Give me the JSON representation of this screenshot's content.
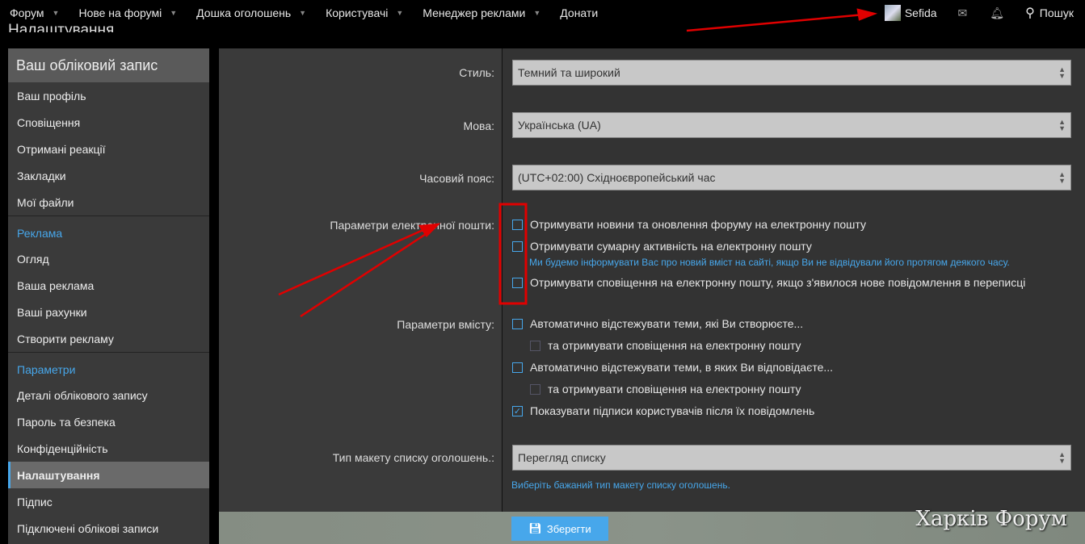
{
  "nav": {
    "items": [
      {
        "label": "Форум",
        "caret": true
      },
      {
        "label": "Нове на форумі",
        "caret": true
      },
      {
        "label": "Дошка оголошень",
        "caret": true
      },
      {
        "label": "Користувачі",
        "caret": true
      },
      {
        "label": "Менеджер реклами",
        "caret": true
      },
      {
        "label": "Донати",
        "caret": false
      }
    ],
    "username": "Sefida",
    "search": "Пошук"
  },
  "page_title": "Налаштування",
  "sidebar": {
    "header": "Ваш обліковий запис",
    "group1": [
      "Ваш профіль",
      "Сповіщення",
      "Отримані реакції",
      "Закладки",
      "Мої файли"
    ],
    "sec2": "Реклама",
    "group2": [
      "Огляд",
      "Ваша реклама",
      "Ваші рахунки",
      "Створити рекламу"
    ],
    "sec3": "Параметри",
    "group3": [
      "Деталі облікового запису",
      "Пароль та безпека",
      "Конфіденційність",
      "Налаштування",
      "Підпис",
      "Підключені облікові записи"
    ]
  },
  "form": {
    "style_label": "Стиль:",
    "style_value": "Темний та широкий",
    "lang_label": "Мова:",
    "lang_value": "Українська (UA)",
    "tz_label": "Часовий пояс:",
    "tz_value": "(UTC+02:00) Східноєвропейський час",
    "email_label": "Параметри електронної пошти:",
    "email_opts": [
      "Отримувати новини та оновлення форуму на електронну пошту",
      "Отримувати сумарну активність на електронну пошту",
      "Отримувати сповіщення на електронну пошту, якщо з'явилося нове повідомлення в переписці"
    ],
    "email_hint": "Ми будемо інформувати Вас про новий вміст на сайті, якщо Ви не відвідували його протягом деякого часу.",
    "content_label": "Параметри вмісту:",
    "content_opts": [
      "Автоматично відстежувати теми, які Ви створюєте...",
      "та отримувати сповіщення на електронну пошту",
      "Автоматично відстежувати теми, в яких Ви відповідаєте...",
      "та отримувати сповіщення на електронну пошту",
      "Показувати підписи користувачів після їх повідомлень"
    ],
    "layout_label": "Тип макету списку оголошень.:",
    "layout_value": "Перегляд списку",
    "layout_hint": "Виберіть бажаний тип макету списку оголошень.",
    "save": "Зберегти"
  },
  "logo": "Харків Форум",
  "colors": {
    "accent": "#47a7eb",
    "annotation": "#e00000"
  }
}
